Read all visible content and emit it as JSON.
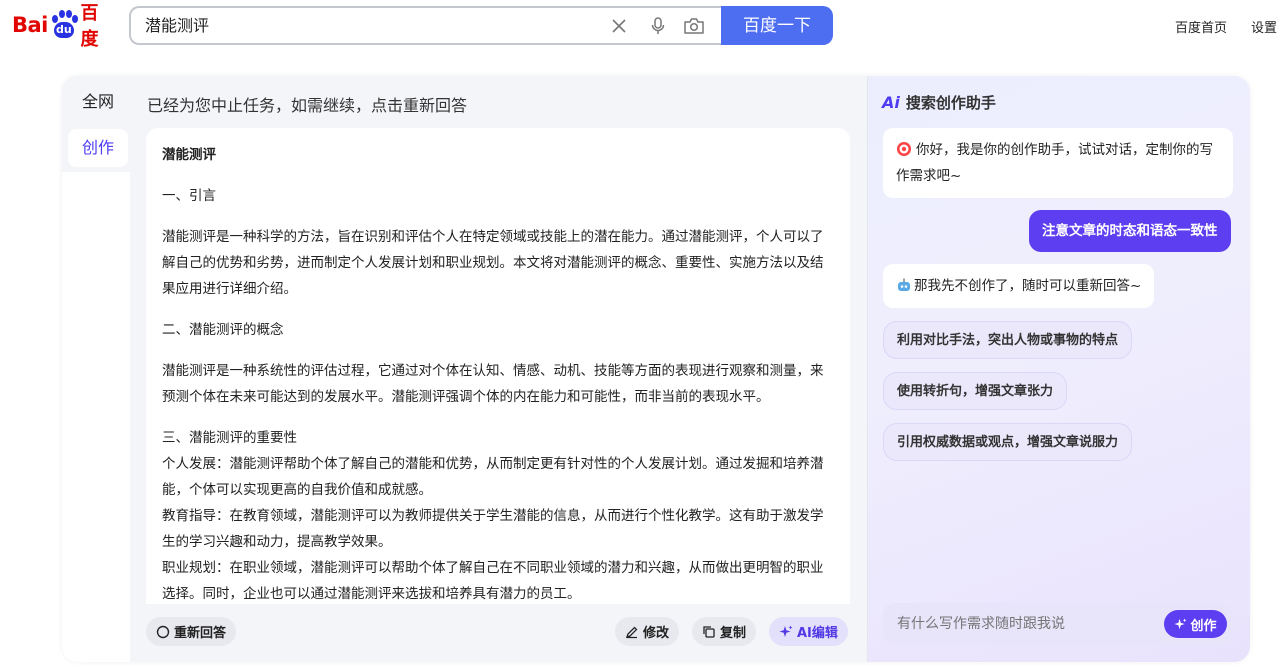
{
  "header": {
    "logo": {
      "text_left": "Bai",
      "text_paw": "du",
      "text_cn": "百度"
    },
    "search": {
      "value": "潜能测评",
      "placeholder": ""
    },
    "search_button": "百度一下",
    "links": [
      "百度首页",
      "设置"
    ]
  },
  "side_tabs": [
    {
      "label": "全网",
      "active": false
    },
    {
      "label": "创作",
      "active": true
    }
  ],
  "notice": "已经为您中止任务，如需继续，点击重新回答",
  "document": {
    "title": "潜能测评",
    "paragraphs": [
      "一、引言",
      "潜能测评是一种科学的方法，旨在识别和评估个人在特定领域或技能上的潜在能力。通过潜能测评，个人可以了解自己的优势和劣势，进而制定个人发展计划和职业规划。本文将对潜能测评的概念、重要性、实施方法以及结果应用进行详细介绍。",
      "二、潜能测评的概念",
      "潜能测评是一种系统性的评估过程，它通过对个体在认知、情感、动机、技能等方面的表现进行观察和测量，来预测个体在未来可能达到的发展水平。潜能测评强调个体的内在能力和可能性，而非当前的表现水平。",
      "三、潜能测评的重要性",
      "个人发展：潜能测评帮助个体了解自己的潜能和优势，从而制定更有针对性的个人发展计划。通过发掘和培养潜能，个体可以实现更高的自我价值和成就感。",
      "教育指导：在教育领域，潜能测评可以为教师提供关于学生潜能的信息，从而进行个性化教学。这有助于激发学生的学习兴趣和动力，提高教学效果。",
      "职业规划：在职业领域，潜能测评可以帮助个体了解自己在不同职业领域的潜力和兴趣，从而做出更明智的职业选择。同时，企业也可以通过潜能测评来选拔和培养具有潜力的员工。"
    ]
  },
  "actions": {
    "regenerate": "重新回答",
    "edit": "修改",
    "copy": "复制",
    "ai_edit": "AI编辑"
  },
  "assistant": {
    "title": "搜索创作助手",
    "greeting": "你好，我是你的创作助手，试试对话，定制你的写作需求吧~",
    "user_message": "注意文章的时态和语态一致性",
    "reply": "那我先不创作了，随时可以重新回答~",
    "suggestions": [
      "利用对比手法，突出人物或事物的特点",
      "使用转折句，增强文章张力",
      "引用权威数据或观点，增强文章说服力"
    ],
    "input_placeholder": "有什么写作需求随时跟我说",
    "create_button": "创作"
  },
  "colors": {
    "brand_red": "#e10602",
    "brand_blue": "#4e6ef2",
    "accent_purple": "#5d3ef0"
  }
}
